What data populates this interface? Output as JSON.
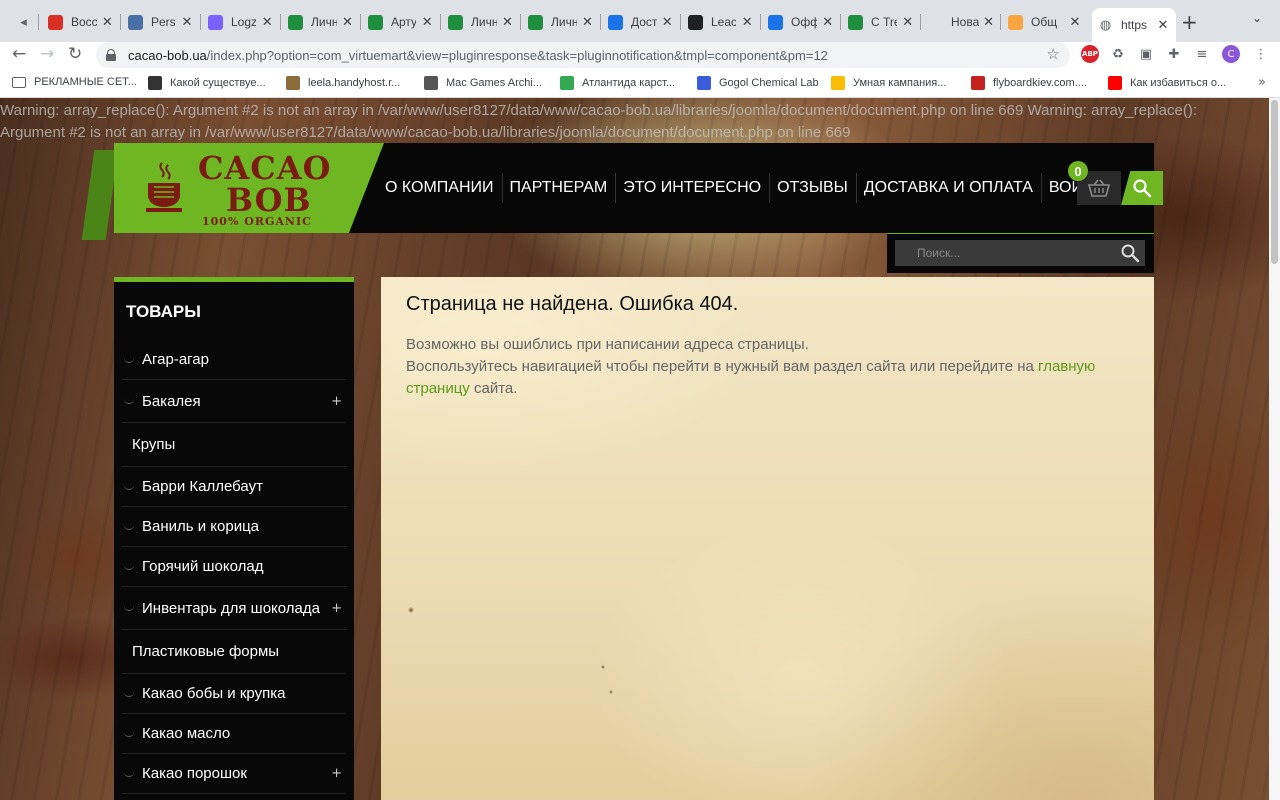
{
  "browser": {
    "tabs": [
      {
        "title": "",
        "icon": "speaker-icon",
        "color": "#5f6368"
      },
      {
        "title": "Восс",
        "icon": "gmail-icon",
        "color": "#d93025"
      },
      {
        "title": "Pers",
        "icon": "folder-icon",
        "color": "#4a6fa5"
      },
      {
        "title": "Logz",
        "icon": "logz-icon",
        "color": "#7b61ff"
      },
      {
        "title": "Личн",
        "icon": "smile-icon",
        "color": "#1e8e3e"
      },
      {
        "title": "Арту",
        "icon": "smile-icon",
        "color": "#1e8e3e"
      },
      {
        "title": "Личн",
        "icon": "smile-icon",
        "color": "#1e8e3e"
      },
      {
        "title": "Личн",
        "icon": "smile-icon",
        "color": "#1e8e3e"
      },
      {
        "title": "Дост",
        "icon": "ad-icon",
        "color": "#1a73e8"
      },
      {
        "title": "Leac",
        "icon": "t-icon",
        "color": "#202124"
      },
      {
        "title": "Офф",
        "icon": "ad-icon",
        "color": "#1a73e8"
      },
      {
        "title": "С Tre",
        "icon": "tre-icon",
        "color": "#1e8e3e"
      },
      {
        "title": "Новая вк",
        "icon": "",
        "color": "#dee1e6"
      },
      {
        "title": "Общ",
        "icon": "joomla-icon",
        "color": "#f9a541"
      },
      {
        "title": "https",
        "icon": "globe-icon",
        "color": "#5f6368"
      }
    ],
    "url_domain": "cacao-bob.ua",
    "url_path": "/index.php?option=com_virtuemart&view=pluginresponse&task=pluginnotification&tmpl=component&pm=12",
    "profile_initial": "C",
    "abp_label": "ABP",
    "bookmarks": [
      {
        "label": "РЕКЛАМНЫЕ СЕТ...",
        "color": "#5f6368"
      },
      {
        "label": "Какой существуе...",
        "color": "#333333"
      },
      {
        "label": "leela.handyhost.r...",
        "color": "#8a6d3b"
      },
      {
        "label": "Mac Games Archi...",
        "color": "#555555"
      },
      {
        "label": "Атлантида карст...",
        "color": "#34a853"
      },
      {
        "label": "Gogol Chemical Lab",
        "color": "#3b5bdb"
      },
      {
        "label": "Умная кампания...",
        "color": "#fbbc04"
      },
      {
        "label": "flyboardkiev.com....",
        "color": "#c5221f"
      },
      {
        "label": "Как избавиться о...",
        "color": "#ff0000"
      }
    ]
  },
  "page": {
    "warning": "Warning: array_replace(): Argument #2 is not an array in /var/www/user8127/data/www/cacao-bob.ua/libraries/joomla/document/document.php on line 669 Warning: array_replace(): Argument #2 is not an array in /var/www/user8127/data/www/cacao-bob.ua/libraries/joomla/document/document.php on line 669",
    "logo": {
      "line1": "CACAO",
      "line2": "BOB",
      "line3": "100% ORGANIC"
    },
    "menu": [
      "О КОМПАНИИ",
      "ПАРТНЕРАМ",
      "ЭТО ИНТЕРЕСНО",
      "ОТЗЫВЫ",
      "ДОСТАВКА И ОПЛАТА",
      "ВОЙТИ"
    ],
    "cart_count": "0",
    "search_placeholder": "Поиск...",
    "sidebar": {
      "title": "ТОВАРЫ",
      "items": [
        {
          "label": "Агар-агар",
          "expandable": false,
          "sub": false
        },
        {
          "label": "Бакалея",
          "expandable": true,
          "sub": false
        },
        {
          "label": "Крупы",
          "expandable": false,
          "sub": true
        },
        {
          "label": "Барри Каллебаут",
          "expandable": false,
          "sub": false
        },
        {
          "label": "Ваниль и корица",
          "expandable": false,
          "sub": false
        },
        {
          "label": "Горячий шоколад",
          "expandable": false,
          "sub": false
        },
        {
          "label": "Инвентарь для шоколада",
          "expandable": true,
          "sub": false
        },
        {
          "label": "Пластиковые формы",
          "expandable": false,
          "sub": true
        },
        {
          "label": "Какао бобы и крупка",
          "expandable": false,
          "sub": false
        },
        {
          "label": "Какао масло",
          "expandable": false,
          "sub": false
        },
        {
          "label": "Какао порошок",
          "expandable": true,
          "sub": false
        }
      ],
      "plus_glyph": "+"
    },
    "content": {
      "heading": "Страница не найдена. Ошибка 404.",
      "line1": "Возможно вы ошиблись при написании адреса страницы.",
      "line2_before": "Воспользуйтесь навигацией чтобы перейти в нужный вам раздел сайта или перейдите на ",
      "line2_link": "главную страницу",
      "line2_after": " сайта."
    }
  },
  "colors": {
    "brand_green": "#6fb623",
    "brand_brown": "#7a1c12",
    "header_bg": "#070707",
    "link": "#5c9c16"
  }
}
